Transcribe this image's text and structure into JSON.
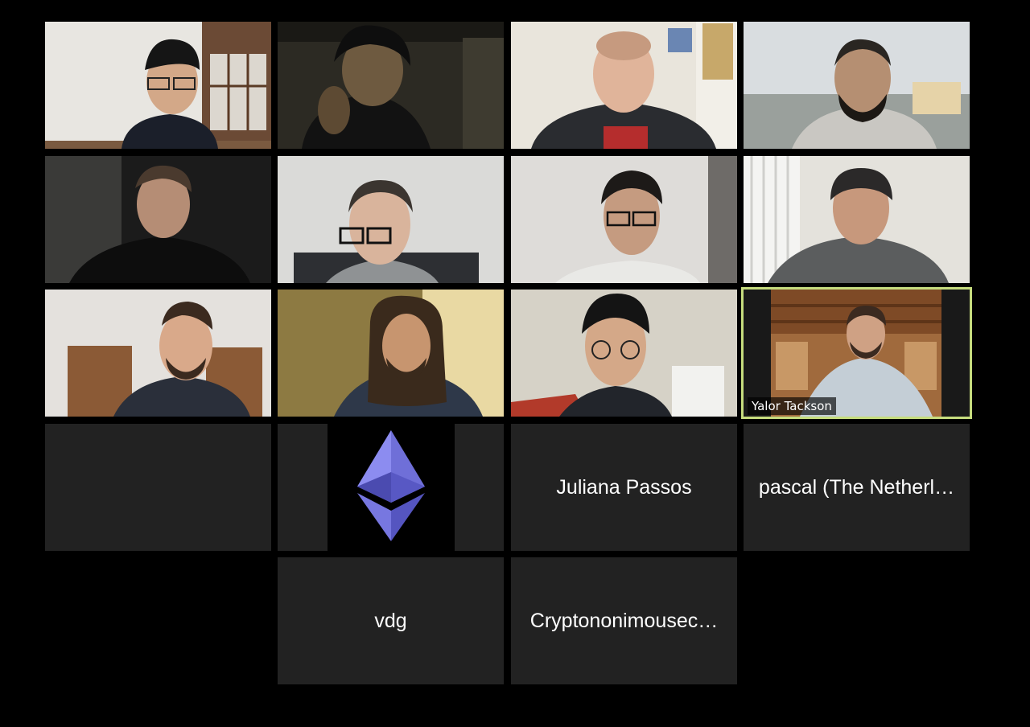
{
  "meeting": {
    "video_participants": [
      {
        "id": "p1",
        "label": ""
      },
      {
        "id": "p2",
        "label": ""
      },
      {
        "id": "p3",
        "label": ""
      },
      {
        "id": "p4",
        "label": ""
      },
      {
        "id": "p5",
        "label": ""
      },
      {
        "id": "p6",
        "label": ""
      },
      {
        "id": "p7",
        "label": ""
      },
      {
        "id": "p8",
        "label": ""
      },
      {
        "id": "p9",
        "label": ""
      },
      {
        "id": "p10",
        "label": ""
      },
      {
        "id": "p11",
        "label": ""
      },
      {
        "id": "p12",
        "label": "Yalor Tackson",
        "active_speaker": true
      }
    ],
    "name_only_participants": [
      {
        "id": "n1",
        "display_name": ""
      },
      {
        "id": "n2",
        "display_name": "",
        "avatar": "ethereum-logo-icon"
      },
      {
        "id": "n3",
        "display_name": "Juliana Passos"
      },
      {
        "id": "n4",
        "display_name": "pascal (The Netherl…"
      },
      {
        "id": "n5",
        "display_name": "vdg"
      },
      {
        "id": "n6",
        "display_name": "Cryptononimousec…"
      }
    ],
    "colors": {
      "background": "#000000",
      "tile": "#222222",
      "active_speaker_border": "#c6dc7e"
    }
  }
}
